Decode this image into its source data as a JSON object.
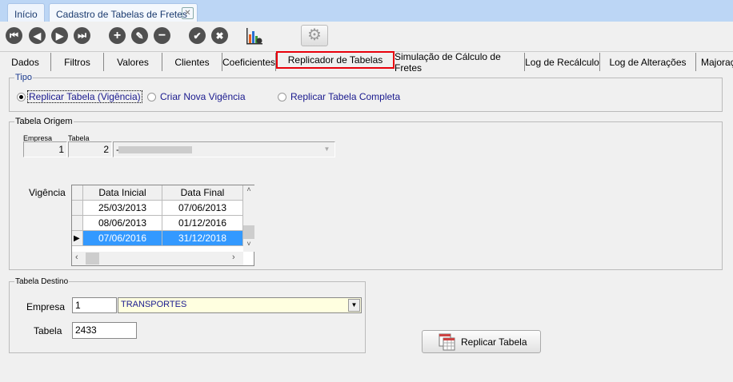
{
  "tabs_top": [
    {
      "label": "Início"
    },
    {
      "label": "Cadastro de Tabelas de Fretes"
    }
  ],
  "tabs": [
    "Dados",
    "Filtros",
    "Valores",
    "Clientes",
    "Coeficientes",
    "Replicador de Tabelas",
    "Simulação de Cálculo de Fretes",
    "Log de Recálculo",
    "Log de Alterações",
    "Majoração"
  ],
  "active_tab": "Replicador de Tabelas",
  "tipo": {
    "legend": "Tipo",
    "options": [
      "Replicar Tabela (Vigência)",
      "Criar Nova Vigência",
      "Replicar Tabela Completa"
    ],
    "selected": 0
  },
  "origem": {
    "legend": "Tabela Origem",
    "empresa_label": "Empresa",
    "tabela_label": "Tabela",
    "empresa": "1",
    "tabela": "2",
    "descricao": "-",
    "vigencia_label": "Vigência",
    "columns": [
      "Data Inicial",
      "Data Final"
    ],
    "rows": [
      [
        "25/03/2013",
        "07/06/2013"
      ],
      [
        "08/06/2013",
        "01/12/2016"
      ],
      [
        "07/06/2016",
        "31/12/2018"
      ]
    ],
    "selected_row": 2
  },
  "destino": {
    "legend": "Tabela Destino",
    "empresa_label": "Empresa",
    "empresa": "1",
    "empresa_nome": "TRANSPORTES",
    "tabela_label": "Tabela",
    "tabela": "2433"
  },
  "replicar_button": "Replicar Tabela",
  "colors": {
    "accent": "#3399ff",
    "highlight": "#e8000b"
  }
}
